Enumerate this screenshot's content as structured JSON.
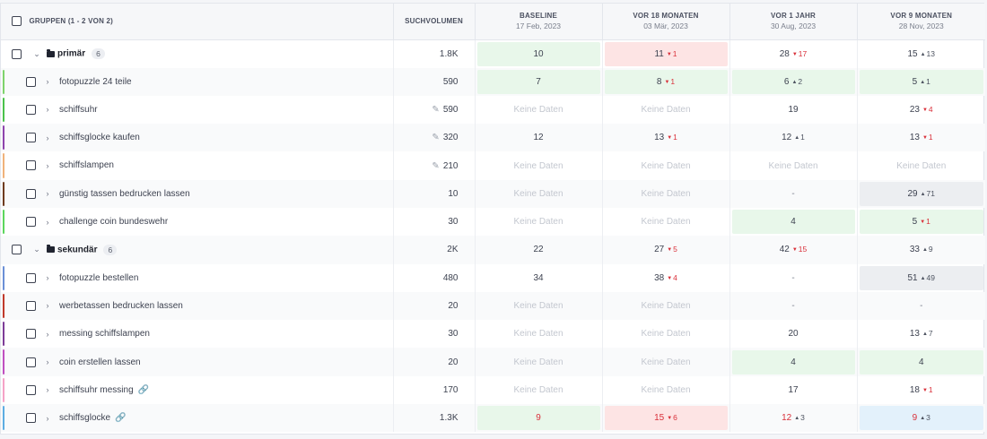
{
  "header": {
    "groups_label": "GRUPPEN (1 - 2 VON 2)",
    "volume_label": "SUCHVOLUMEN",
    "periods": [
      {
        "title": "BASELINE",
        "date": "17 Feb, 2023"
      },
      {
        "title": "VOR 18 MONATEN",
        "date": "03 Mär, 2023"
      },
      {
        "title": "VOR 1 JAHR",
        "date": "30 Aug, 2023"
      },
      {
        "title": "VOR 9 MONATEN",
        "date": "28 Nov, 2023"
      }
    ]
  },
  "no_data_label": "Keine Daten",
  "groups": [
    {
      "name": "primär",
      "count": "6",
      "volume": "1.8K",
      "cells": [
        {
          "v": "10",
          "bg": "green"
        },
        {
          "v": "11",
          "ch": "1",
          "dir": "down",
          "bg": "red"
        },
        {
          "v": "28",
          "ch": "17",
          "dir": "down"
        },
        {
          "v": "15",
          "ch": "13",
          "dir": "up"
        }
      ],
      "keywords": [
        {
          "name": "fotopuzzle 24 teile",
          "volume": "590",
          "bar": "#7ed36b",
          "cells": [
            {
              "v": "7",
              "bg": "green"
            },
            {
              "v": "8",
              "ch": "1",
              "dir": "down",
              "bg": "green"
            },
            {
              "v": "6",
              "ch": "2",
              "dir": "up",
              "bg": "green"
            },
            {
              "v": "5",
              "ch": "1",
              "dir": "up",
              "bg": "green"
            }
          ]
        },
        {
          "name": "schiffsuhr",
          "volume": "590",
          "pencil": true,
          "bar": "#4bc24b",
          "cells": [
            {
              "nd": true
            },
            {
              "nd": true
            },
            {
              "v": "19"
            },
            {
              "v": "23",
              "ch": "4",
              "dir": "down"
            }
          ]
        },
        {
          "name": "schiffsglocke kaufen",
          "volume": "320",
          "pencil": true,
          "bar": "#8e44ad",
          "cells": [
            {
              "v": "12"
            },
            {
              "v": "13",
              "ch": "1",
              "dir": "down"
            },
            {
              "v": "12",
              "ch": "1",
              "dir": "up"
            },
            {
              "v": "13",
              "ch": "1",
              "dir": "down"
            }
          ]
        },
        {
          "name": "schiffslampen",
          "volume": "210",
          "pencil": true,
          "bar": "#f0b27a",
          "cells": [
            {
              "nd": true
            },
            {
              "nd": true
            },
            {
              "nd": true
            },
            {
              "nd": true
            }
          ]
        },
        {
          "name": "günstig tassen bedrucken lassen",
          "volume": "10",
          "bar": "#6e3b1f",
          "cells": [
            {
              "nd": true
            },
            {
              "nd": true
            },
            {
              "v": "-",
              "dash": true
            },
            {
              "v": "29",
              "ch": "71",
              "dir": "up",
              "bg": "gray"
            }
          ]
        },
        {
          "name": "challenge coin bundeswehr",
          "volume": "30",
          "bar": "#5cd65c",
          "cells": [
            {
              "nd": true
            },
            {
              "nd": true
            },
            {
              "v": "4",
              "bg": "green"
            },
            {
              "v": "5",
              "ch": "1",
              "dir": "down",
              "bg": "green"
            }
          ]
        }
      ]
    },
    {
      "name": "sekundär",
      "count": "6",
      "volume": "2K",
      "cells": [
        {
          "v": "22"
        },
        {
          "v": "27",
          "ch": "5",
          "dir": "down"
        },
        {
          "v": "42",
          "ch": "15",
          "dir": "down"
        },
        {
          "v": "33",
          "ch": "9",
          "dir": "up"
        }
      ],
      "keywords": [
        {
          "name": "fotopuzzle bestellen",
          "volume": "480",
          "bar": "#6b8fd6",
          "cells": [
            {
              "v": "34"
            },
            {
              "v": "38",
              "ch": "4",
              "dir": "down"
            },
            {
              "v": "-",
              "dash": true
            },
            {
              "v": "51",
              "ch": "49",
              "dir": "up",
              "bg": "gray"
            }
          ]
        },
        {
          "name": "werbetassen bedrucken lassen",
          "volume": "20",
          "bar": "#c0392b",
          "cells": [
            {
              "nd": true
            },
            {
              "nd": true
            },
            {
              "v": "-",
              "dash": true
            },
            {
              "v": "-",
              "dash": true
            }
          ]
        },
        {
          "name": "messing schiffslampen",
          "volume": "30",
          "bar": "#7d3c98",
          "cells": [
            {
              "nd": true
            },
            {
              "nd": true
            },
            {
              "v": "20"
            },
            {
              "v": "13",
              "ch": "7",
              "dir": "up"
            }
          ]
        },
        {
          "name": "coin erstellen lassen",
          "volume": "20",
          "bar": "#c04fc0",
          "cells": [
            {
              "nd": true
            },
            {
              "nd": true
            },
            {
              "v": "4",
              "bg": "green"
            },
            {
              "v": "4",
              "bg": "green"
            }
          ]
        },
        {
          "name": "schiffsuhr messing",
          "volume": "170",
          "link": true,
          "bar": "#f5a3c7",
          "cells": [
            {
              "nd": true
            },
            {
              "nd": true
            },
            {
              "v": "17"
            },
            {
              "v": "18",
              "ch": "1",
              "dir": "down"
            }
          ]
        },
        {
          "name": "schiffsglocke",
          "volume": "1.3K",
          "link": true,
          "bar": "#5dade2",
          "cells": [
            {
              "v": "9",
              "bg": "green",
              "red": true
            },
            {
              "v": "15",
              "ch": "6",
              "dir": "down",
              "bg": "red",
              "red": true
            },
            {
              "v": "12",
              "ch": "3",
              "dir": "up",
              "red": true
            },
            {
              "v": "9",
              "ch": "3",
              "dir": "up",
              "bg": "blue",
              "red": true
            }
          ]
        }
      ]
    }
  ]
}
